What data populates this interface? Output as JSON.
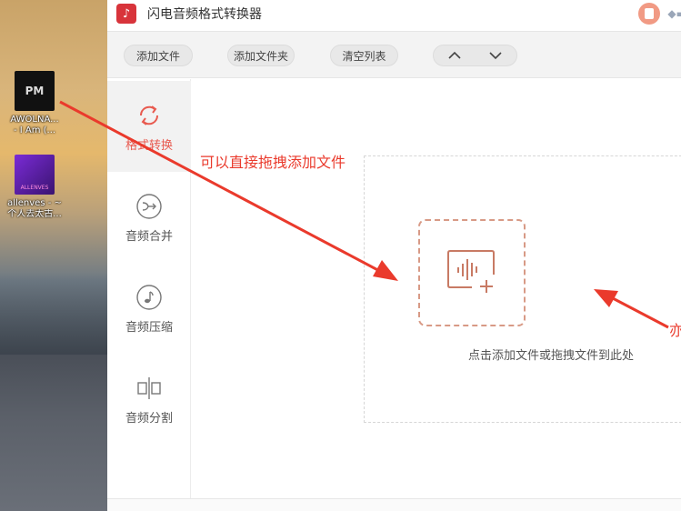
{
  "desktop": {
    "icons": [
      {
        "label_line1": "AWOLNA...",
        "label_line2": "- I Am (...",
        "thumb_text": "PM"
      },
      {
        "label_line1": "allenves - ~",
        "label_line2": "个人去太古...",
        "thumb_text": "ALLENVES"
      }
    ]
  },
  "app": {
    "title": "闪电音频格式转换器",
    "logo_glyph": "♪"
  },
  "toolbar": {
    "add_file": "添加文件",
    "add_folder": "添加文件夹",
    "clear_list": "清空列表"
  },
  "sidebar": {
    "items": [
      {
        "label": "格式转换",
        "icon": "refresh-icon"
      },
      {
        "label": "音频合并",
        "icon": "merge-icon"
      },
      {
        "label": "音频压缩",
        "icon": "music-note-icon"
      },
      {
        "label": "音频分割",
        "icon": "split-icon"
      }
    ]
  },
  "main": {
    "drop_hint": "点击添加文件或拖拽文件到此处"
  },
  "annotations": {
    "drag_note": "可以直接拖拽添加文件",
    "right_note": "亦"
  },
  "colors": {
    "accent": "#e85a4f",
    "annotation": "#ea3a2c",
    "logo": "#d8343b"
  }
}
